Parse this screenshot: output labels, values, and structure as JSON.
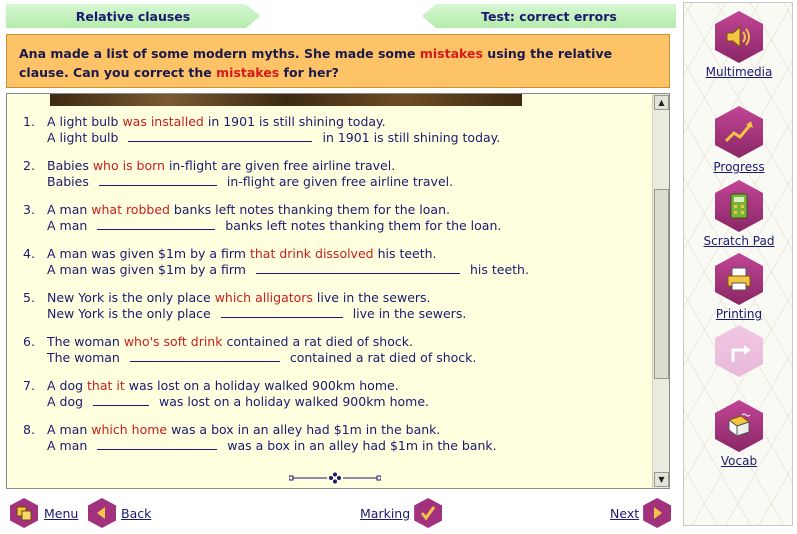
{
  "tabs": {
    "left": "Relative clauses",
    "right": "Test: correct errors"
  },
  "instruction": {
    "part1": "Ana made a list of some modern myths. She made some ",
    "mistakes1": "mistakes",
    "part2": " using the relative clause. Can you correct the ",
    "mistakes2": "mistakes",
    "part3": " for her?"
  },
  "items": [
    {
      "num": "1.",
      "pre": "A light bulb ",
      "err": "was installed",
      "post": " in 1901 is still shining today.",
      "line2_pre": "A light bulb",
      "line2_post": "in 1901 is still shining today."
    },
    {
      "num": "2.",
      "pre": "Babies ",
      "err": "who is born",
      "post": " in-flight are given free airline travel.",
      "line2_pre": "Babies",
      "line2_post": "in-flight are given free airline travel."
    },
    {
      "num": "3.",
      "pre": "A man ",
      "err": "what robbed",
      "post": " banks left notes thanking them for the loan.",
      "line2_pre": "A man",
      "line2_post": "banks left notes thanking them for the loan."
    },
    {
      "num": "4.",
      "pre": "A man was given $1m by a firm ",
      "err": "that drink dissolved",
      "post": " his teeth.",
      "line2_pre": "A man was given $1m by a firm",
      "line2_post": "his teeth."
    },
    {
      "num": "5.",
      "pre": "New York is the only place ",
      "err": "which alligators",
      "post": " live in the sewers.",
      "line2_pre": "New York is the only place",
      "line2_post": "live in the sewers."
    },
    {
      "num": "6.",
      "pre": "The woman ",
      "err": "who's soft drink",
      "post": " contained a rat died of shock.",
      "line2_pre": "The woman",
      "line2_post": "contained a rat died of shock."
    },
    {
      "num": "7.",
      "pre": "A dog ",
      "err": "that it",
      "post": " was lost on a holiday walked 900km home.",
      "line2_pre": "A dog",
      "line2_post": "was lost on a holiday walked 900km home."
    },
    {
      "num": "8.",
      "pre": "A man ",
      "err": "which home",
      "post": " was a box in an alley had $1m in the bank.",
      "line2_pre": "A man",
      "line2_post": "was a box in an alley had $1m in the bank."
    }
  ],
  "nav": {
    "menu": "Menu",
    "back": "Back",
    "marking": "Marking",
    "next": "Next"
  },
  "sidebar": {
    "multimedia": "Multimedia",
    "progress": "Progress",
    "scratch_pad": "Scratch Pad",
    "printing": "Printing",
    "vocab": "Vocab"
  },
  "colors": {
    "accent": "#a3327e",
    "instruction_bg": "#fec267",
    "panel_bg": "#ffffe0",
    "tab_bg": "#c4f1bd",
    "error_red": "#c81e1e"
  },
  "icons": {
    "multimedia": "speaker-icon",
    "progress": "chart-icon",
    "scratch_pad": "calculator-icon",
    "printing": "printer-icon",
    "disabled": "arrow-icon",
    "vocab": "dictionary-icon"
  }
}
